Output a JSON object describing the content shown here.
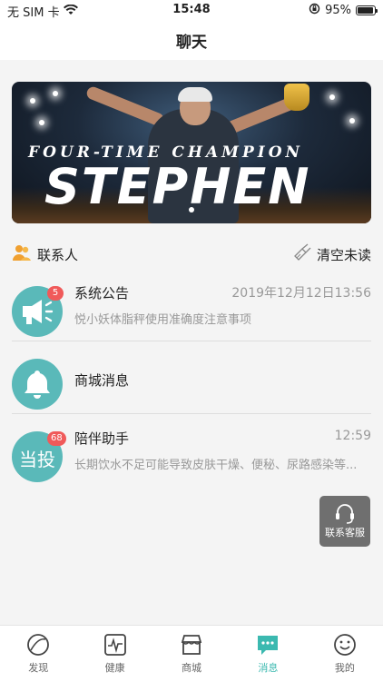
{
  "status_bar": {
    "carrier": "无 SIM 卡",
    "time": "15:48",
    "battery": "95%",
    "battery_level": 0.95
  },
  "nav": {
    "title": "聊天"
  },
  "banner": {
    "small_text": "FOUR-TIME CHAMPION",
    "big_text": "STEPHEN"
  },
  "contacts": {
    "left_label": "联系人",
    "right_label": "清空未读"
  },
  "messages": [
    {
      "name": "系统公告",
      "time": "2019年12月12日13:56",
      "preview": "悦小妖体脂秤使用准确度注意事项",
      "badge": "5"
    },
    {
      "name": "商城消息",
      "time": "",
      "preview": "",
      "badge": ""
    },
    {
      "name": "陪伴助手",
      "time": "12:59",
      "preview": "长期饮水不足可能导致皮肤干燥、便秘、尿路感染等...",
      "badge": "68",
      "avatar_text": "当投"
    }
  ],
  "support": {
    "label": "联系客服"
  },
  "tabs": [
    {
      "label": "发现",
      "icon": "discover-icon"
    },
    {
      "label": "健康",
      "icon": "health-icon"
    },
    {
      "label": "商城",
      "icon": "store-icon"
    },
    {
      "label": "消息",
      "icon": "message-icon",
      "active": true
    },
    {
      "label": "我的",
      "icon": "profile-icon"
    }
  ],
  "colors": {
    "accent": "#3bb9b0",
    "avatar": "#5ab9b9",
    "badge": "#f05a5a",
    "contacts_icon": "#f0a030"
  }
}
